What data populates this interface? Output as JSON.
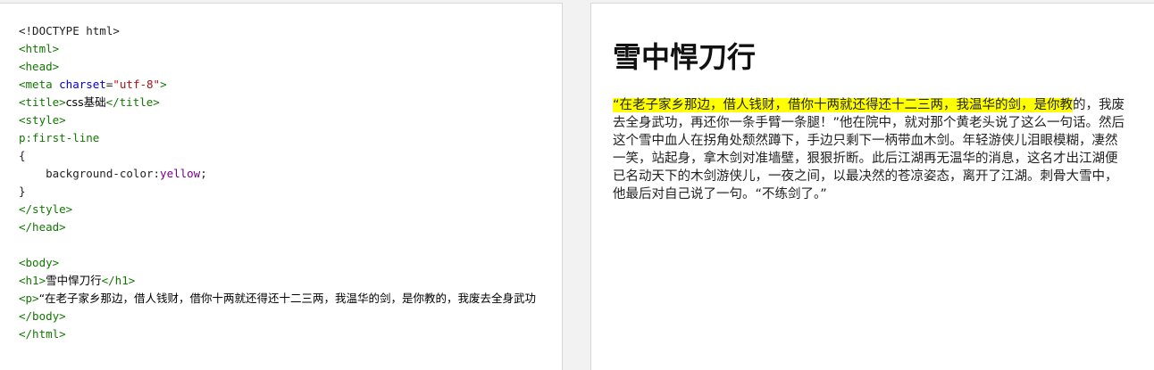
{
  "editor": {
    "lines": [
      {
        "parts": [
          {
            "c": "",
            "t": "<!DOCTYPE html>"
          }
        ]
      },
      {
        "parts": [
          {
            "c": "tag",
            "t": "<html>"
          }
        ]
      },
      {
        "parts": [
          {
            "c": "tag",
            "t": "<head>"
          }
        ]
      },
      {
        "parts": [
          {
            "c": "tag",
            "t": "<meta "
          },
          {
            "c": "attr",
            "t": "charset"
          },
          {
            "c": "",
            "t": "="
          },
          {
            "c": "str",
            "t": "\"utf-8\""
          },
          {
            "c": "tag",
            "t": ">"
          }
        ]
      },
      {
        "parts": [
          {
            "c": "tag",
            "t": "<title>"
          },
          {
            "c": "txt",
            "t": "css基础"
          },
          {
            "c": "tag",
            "t": "</title>"
          }
        ]
      },
      {
        "parts": [
          {
            "c": "tag",
            "t": "<style>"
          }
        ]
      },
      {
        "parts": [
          {
            "c": "kw",
            "t": "p:first-line"
          }
        ]
      },
      {
        "parts": [
          {
            "c": "",
            "t": "{"
          }
        ]
      },
      {
        "parts": [
          {
            "c": "",
            "t": "    background-color:"
          },
          {
            "c": "val",
            "t": "yellow"
          },
          {
            "c": "",
            "t": ";"
          }
        ]
      },
      {
        "parts": [
          {
            "c": "",
            "t": "}"
          }
        ]
      },
      {
        "parts": [
          {
            "c": "tag",
            "t": "</style>"
          }
        ]
      },
      {
        "parts": [
          {
            "c": "tag",
            "t": "</head>"
          }
        ]
      },
      {
        "parts": [
          {
            "c": "",
            "t": ""
          }
        ]
      },
      {
        "parts": [
          {
            "c": "tag",
            "t": "<body>"
          }
        ]
      },
      {
        "parts": [
          {
            "c": "tag",
            "t": "<h1>"
          },
          {
            "c": "txt",
            "t": "雪中悍刀行"
          },
          {
            "c": "tag",
            "t": "</h1>"
          }
        ]
      },
      {
        "parts": [
          {
            "c": "tag",
            "t": "<p>"
          },
          {
            "c": "txt",
            "t": "“在老子家乡那边，借人钱财，借你十两就还得还十二三两，我温华的剑，是你教的，我废去全身武功"
          }
        ]
      },
      {
        "parts": [
          {
            "c": "tag",
            "t": "</body>"
          }
        ]
      },
      {
        "parts": [
          {
            "c": "tag",
            "t": "</html>"
          }
        ]
      }
    ]
  },
  "preview": {
    "heading": "雪中悍刀行",
    "first_line": "“在老子家乡那边，借人钱财，借你十两就还得还十二三两，我温华的剑，是你教",
    "rest": "的，我废去全身武功，再还你一条手臂一条腿！”他在院中，就对那个黄老头说了这么一句话。然后这个雪中血人在拐角处颓然蹲下，手边只剩下一柄带血木剑。年轻游侠儿泪眼模糊，凄然一笑，站起身，拿木剑对准墙壁，狠狠折断。此后江湖再无温华的消息，这名才出江湖便已名动天下的木剑游侠儿，一夜之间，以最决然的苍凉姿态，离开了江湖。刺骨大雪中，他最后对自己说了一句。“不练剑了。”"
  }
}
